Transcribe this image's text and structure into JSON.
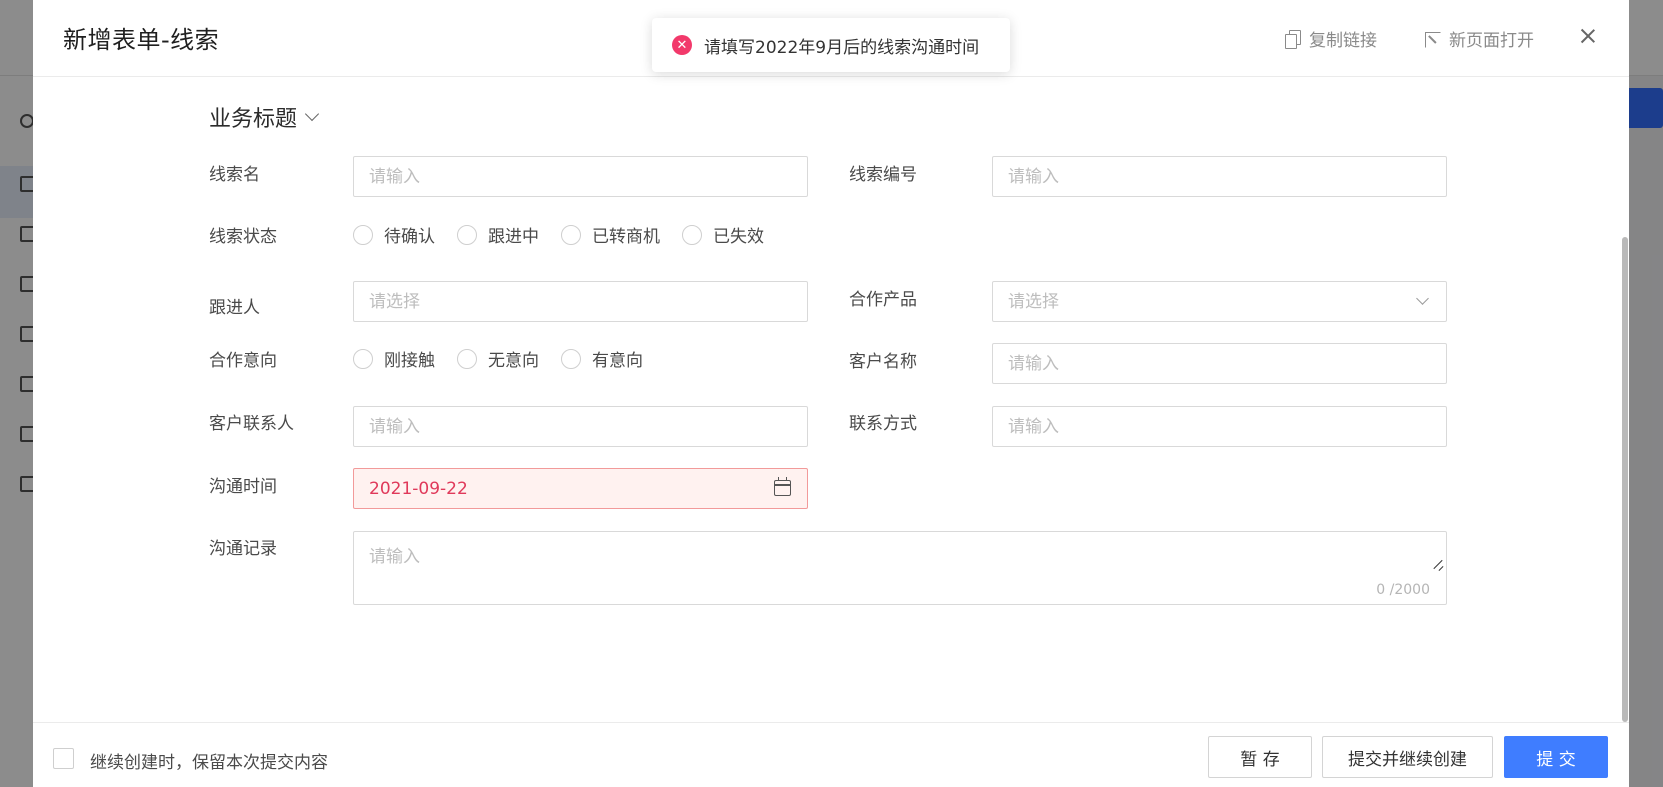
{
  "modal": {
    "title": "新增表单-线索",
    "copy_link": "复制链接",
    "open_new_page": "新页面打开"
  },
  "toast": {
    "message": "请填写2022年9月后的线索沟通时间",
    "type": "error"
  },
  "form": {
    "section_title": "业务标题",
    "fields": {
      "clue_name": {
        "label": "线索名",
        "placeholder": "请输入"
      },
      "clue_number": {
        "label": "线索编号",
        "placeholder": "请输入"
      },
      "clue_status": {
        "label": "线索状态",
        "options": [
          "待确认",
          "跟进中",
          "已转商机",
          "已失效"
        ]
      },
      "follower": {
        "label": "跟进人",
        "placeholder": "请选择"
      },
      "product": {
        "label": "合作产品",
        "placeholder": "请选择"
      },
      "intention": {
        "label": "合作意向",
        "options": [
          "刚接触",
          "无意向",
          "有意向"
        ]
      },
      "customer_name": {
        "label": "客户名称",
        "placeholder": "请输入"
      },
      "contact_person": {
        "label": "客户联系人",
        "placeholder": "请输入"
      },
      "contact_method": {
        "label": "联系方式",
        "placeholder": "请输入"
      },
      "comm_time": {
        "label": "沟通时间",
        "value": "2021-09-22"
      },
      "comm_record": {
        "label": "沟通记录",
        "placeholder": "请输入",
        "counter": "0 /2000"
      }
    }
  },
  "footer": {
    "keep_label": "继续创建时，保留本次提交内容",
    "save_draft": "暂 存",
    "submit_continue": "提交并继续创建",
    "submit": "提 交"
  },
  "colors": {
    "primary": "#3f7dff",
    "error": "#f2396b",
    "error_bg": "#fff2f0"
  }
}
